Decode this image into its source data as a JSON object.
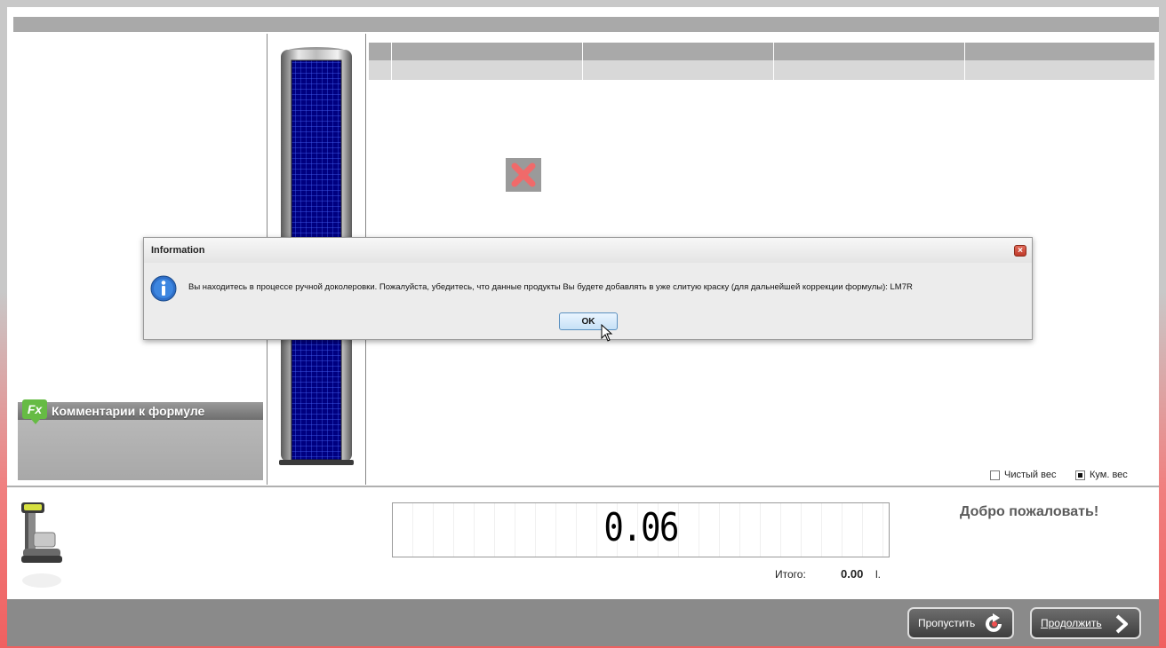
{
  "comments": {
    "badge": "Fx",
    "title": "Комментарии к формуле"
  },
  "table": {
    "columns": [
      "",
      "",
      "",
      ""
    ],
    "rows": [
      [
        "",
        "",
        "",
        ""
      ]
    ]
  },
  "checkboxes": [
    {
      "label": "Чистый вес",
      "checked": false
    },
    {
      "label": "Кум. вес",
      "checked": true
    }
  ],
  "display": {
    "value": "0.06"
  },
  "total": {
    "label": "Итого:",
    "value": "0.00",
    "unit": "l."
  },
  "welcome": "Добро пожаловать!",
  "buttons": {
    "skip": "Пропустить",
    "continue": "Продолжить"
  },
  "dialog": {
    "title": "Information",
    "message": "Вы находитесь в процессе ручной доколеровки. Пожалуйста, убедитесь, что данные продукты Вы будете добавлять в уже слитую краску (для дальнейшей коррекции формулы): LM7R",
    "ok_label": "OK"
  },
  "icons": {
    "error": "close-x-icon",
    "dialog_info": "info-icon",
    "dialog_close": "close-icon",
    "scale": "scale-icon",
    "skip": "rotate-icon",
    "continue": "arrow-right-icon"
  },
  "colors": {
    "accent_red": "#f06060",
    "fx_green": "#66bb44",
    "cylinder_blue": "#000080"
  }
}
